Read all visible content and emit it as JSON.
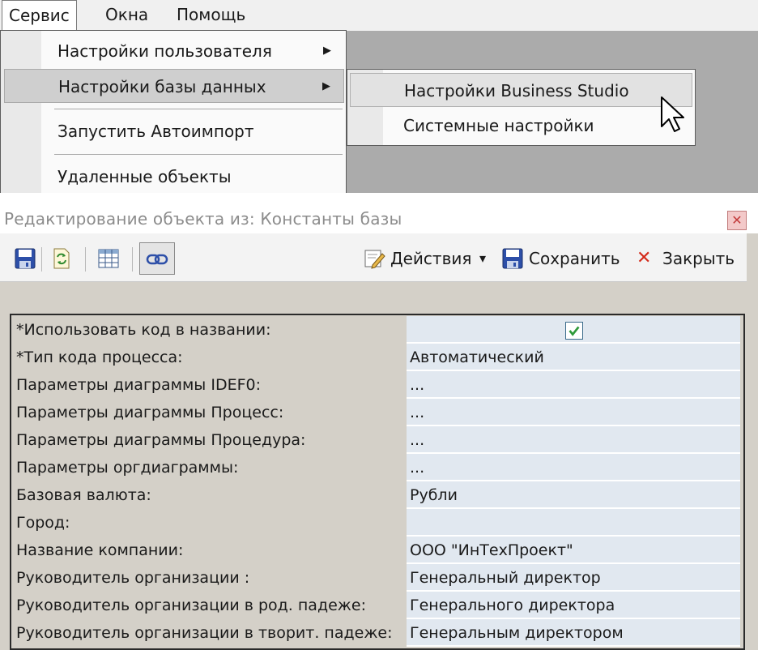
{
  "menubar": {
    "items": [
      "Сервис",
      "Окна",
      "Помощь"
    ]
  },
  "service_menu": {
    "items": [
      {
        "label": "Настройки пользователя",
        "arrow": "▶"
      },
      {
        "label": "Настройки базы данных",
        "arrow": "▶"
      },
      {
        "label": "Запустить Автоимпорт"
      },
      {
        "label": "Удаленные объекты"
      }
    ]
  },
  "db_submenu": {
    "items": [
      {
        "label": "Настройки Business Studio"
      },
      {
        "label": "Системные настройки"
      }
    ]
  },
  "dialog": {
    "title": "Редактирование объекта из: Константы базы",
    "close_glyph": "✕"
  },
  "toolbar": {
    "actions_label": "Действия",
    "dropdown_glyph": "▾",
    "save_label": "Сохранить",
    "close_label": "Закрыть",
    "close_glyph": "✕"
  },
  "properties": [
    {
      "label": "*Использовать код в названии:",
      "value": "",
      "checked": true
    },
    {
      "label": "*Тип кода процесса:",
      "value": "Автоматический"
    },
    {
      "label": "Параметры диаграммы IDEF0:",
      "value": "..."
    },
    {
      "label": "Параметры диаграммы Процесс:",
      "value": "..."
    },
    {
      "label": "Параметры диаграммы Процедура:",
      "value": "..."
    },
    {
      "label": "Параметры оргдиаграммы:",
      "value": "..."
    },
    {
      "label": "Базовая валюта:",
      "value": "Рубли"
    },
    {
      "label": "Город:",
      "value": ""
    },
    {
      "label": "Название компании:",
      "value": "ООО \"ИнТехПроект\""
    },
    {
      "label": "Руководитель организации :",
      "value": "Генеральный директор"
    },
    {
      "label": "Руководитель организации в род. падеже:",
      "value": "Генерального директора"
    },
    {
      "label": "Руководитель организации в творит. падеже:",
      "value": "Генеральным директором"
    }
  ],
  "colors": {
    "desktop_gray": "#ababab",
    "grid_value_bg": "#e1e8f0",
    "close_red": "#c23a3a"
  }
}
